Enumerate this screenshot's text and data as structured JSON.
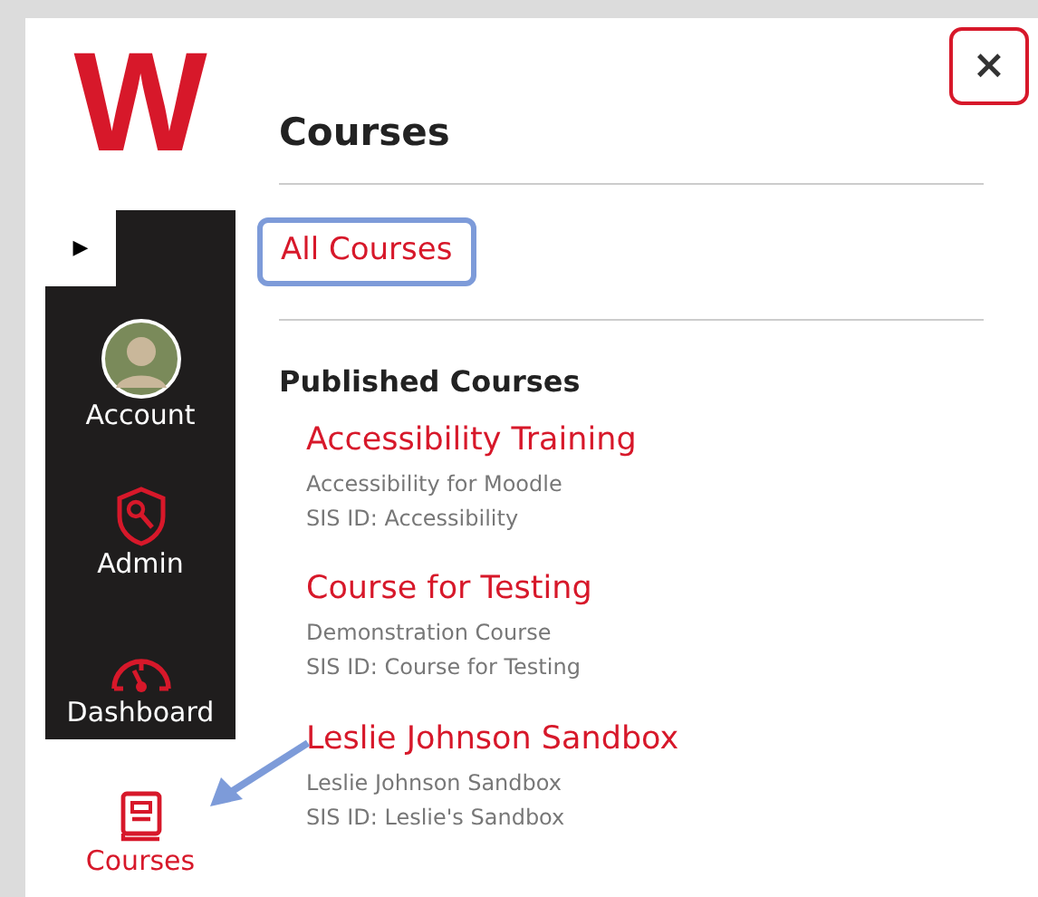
{
  "logo": {
    "letter": "W"
  },
  "nav": {
    "toggle": "▶",
    "items": [
      {
        "kind": "avatar",
        "label": "Account",
        "selected": false
      },
      {
        "kind": "admin",
        "label": "Admin",
        "selected": false
      },
      {
        "kind": "dashboard",
        "label": "Dashboard",
        "selected": false
      },
      {
        "kind": "courses",
        "label": "Courses",
        "selected": true
      }
    ]
  },
  "tray": {
    "title": "Courses",
    "close": "×",
    "all_link": "All Courses",
    "section": "Published Courses",
    "courses": [
      {
        "name": "Accessibility Training",
        "term": "Accessibility for Moodle",
        "sis": "SIS ID: Accessibility"
      },
      {
        "name": "Course for Testing",
        "term": "Demonstration Course",
        "sis": "SIS ID: Course for Testing"
      },
      {
        "name": "Leslie Johnson Sandbox",
        "term": "Leslie Johnson Sandbox",
        "sis": "SIS ID: Leslie's Sandbox"
      }
    ]
  }
}
